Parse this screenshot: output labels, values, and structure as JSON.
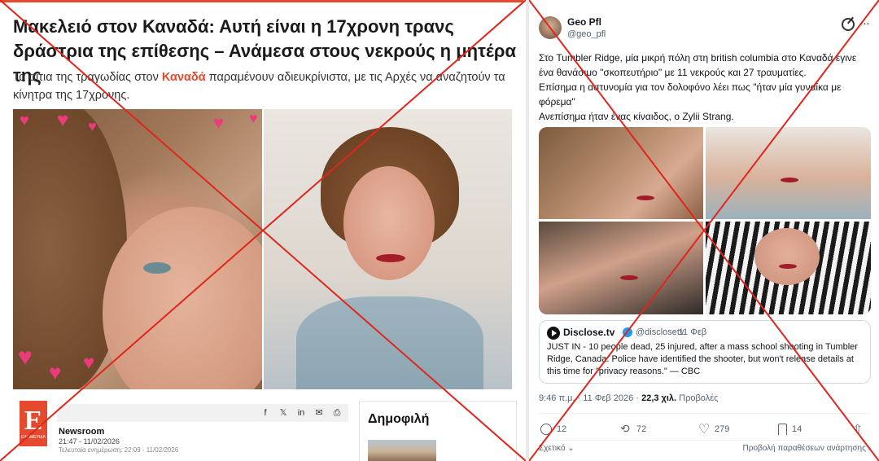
{
  "article": {
    "headline": "Μακελειό στον Καναδά: Αυτή είναι η 17χρονη τρανς δράστρια της επίθεσης – Ανάμεσα στους νεκρούς η μητέρα της",
    "lede_before": "Τα αίτια της τραγωδίας στον ",
    "lede_keyword": "Καναδά",
    "lede_after": " παραμένουν αδιευκρίνιστα, με τις Αρχές να αναζητούν τα κίνητρα της 17χρονης.",
    "logo_letter": "E",
    "logo_small": "ΕΦΗΜΕΡΙΔΑ",
    "share_icons": [
      "facebook-icon",
      "x-icon",
      "linkedin-icon",
      "email-icon",
      "print-icon"
    ],
    "share_glyphs": [
      "f",
      "𝕏",
      "in",
      "✉",
      "⎙"
    ],
    "author": "Newsroom",
    "published": "21:47 - 11/02/2026",
    "updated": "Τελευταία ενημέρωση: 22:09 - 11/02/2026",
    "popular_title": "Δημοφιλή"
  },
  "tweet": {
    "name": "Geo Pfl",
    "handle": "@geo_pfl",
    "more": "···",
    "text_lines": [
      "Στο Tumbler Ridge, μία μικρή πόλη στη british columbia στο Καναδά έγινε ένα θανάσιμο \"σκοπευτήριο\" με 11 νεκρούς και 27 τραυματίες.",
      "Επίσημα η αστυνομία για τον δολοφόνο λέει πως \"ήταν μία γυναίκα με φόρεμα\"",
      "Ανεπίσημα ήταν ένας κίναιδος, ο Zylii Strang."
    ],
    "quote": {
      "name": "Disclose.tv",
      "verified": "✓",
      "handle": "@disclosetv",
      "date": "· 11 Φεβ",
      "text": "JUST IN - 10 people dead, 25 injured, after a mass school shooting in Tumbler Ridge, Canada. Police have identified the shooter, but won't release details at this time for \"privacy reasons.\" — CBC"
    },
    "meta_time": "9:46 π.μ. · 11 Φεβ 2026 · ",
    "meta_views": "22,3 χιλ.",
    "meta_views_label": " Προβολές",
    "replies": "12",
    "retweets": "72",
    "likes": "279",
    "bookmarks": "14",
    "related": "Σχετικό",
    "quotes_link": "Προβολή παραθέσεων ανάρτησης"
  },
  "colors": {
    "accent": "#e64a2e",
    "cross": "#e0261c",
    "verified": "#1d9bf0"
  }
}
